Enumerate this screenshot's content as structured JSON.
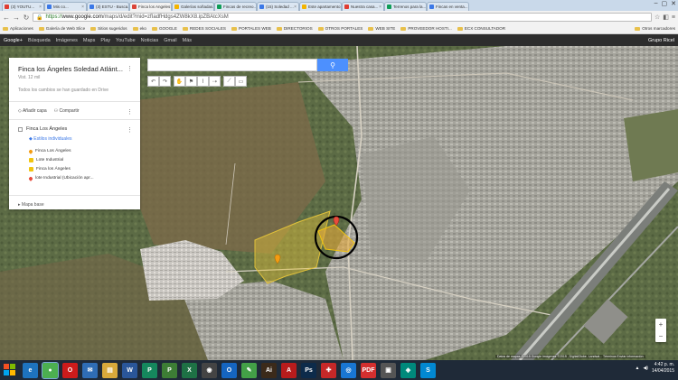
{
  "browser": {
    "tabs": [
      {
        "label": "(3) YOUTU...",
        "fav": "#e03c31",
        "active": false
      },
      {
        "label": "Mis co...",
        "fav": "#3b78e7",
        "active": false
      },
      {
        "label": "(3) ESTU - Busca...",
        "fav": "#3b78e7",
        "active": false
      },
      {
        "label": "Finca los Angeles",
        "fav": "#db4437",
        "active": true
      },
      {
        "label": "Galerías soñadas...",
        "fav": "#f4b400",
        "active": false
      },
      {
        "label": "Fincas de recreo...",
        "fav": "#0f9d58",
        "active": false
      },
      {
        "label": "(15) Soledad ...",
        "fav": "#3b78e7",
        "active": false
      },
      {
        "label": "Este apartamento...",
        "fav": "#f4b400",
        "active": false
      },
      {
        "label": "Nuestra casa...",
        "fav": "#e03c31",
        "active": false
      },
      {
        "label": "Terrenos para la...",
        "fav": "#0f9d58",
        "active": false
      },
      {
        "label": "Fincas en venta...",
        "fav": "#3b78e7",
        "active": false
      }
    ],
    "url_scheme": "https://",
    "url_host": "www.google.com",
    "url_path": "/maps/d/edit?mid=zfIadfHdgs4ZW8kX8.ipZBAtcXsM",
    "bookmarks": [
      "Aplicaciones",
      "Galería de Web Slice",
      "Sitios sugeridos",
      "eko",
      "GOOGLE",
      "REDES SOCIALES",
      "PORTALES WEB",
      "DIRECTORIOS",
      "OTROS PORTALES",
      "WEB SITE",
      "PROVEEDOR HOSTI...",
      "ECX CONSULTADOR"
    ],
    "bookmarks_other": "Otros marcadores"
  },
  "gbar": {
    "items": [
      "Google+",
      "Búsqueda",
      "Imágenes",
      "Maps",
      "Play",
      "YouTube",
      "Noticias",
      "Gmail",
      "Más"
    ],
    "user": "Grupo Ricel"
  },
  "map": {
    "search_placeholder": "",
    "panel": {
      "title": "Finca los Ángeles Soledad Atlánt...",
      "views": "Vist. 12 mil",
      "saved": "Todos los cambios se han guardado en Drive",
      "add_layer": "Añadir capa",
      "share": "Compartir",
      "layer_name": "Finca Los Ángeles",
      "style_link": "Estilos individuales",
      "items": [
        {
          "label": "Finca Los Ángeles",
          "color": "#f39c12",
          "shape": "pin"
        },
        {
          "label": "Lote Industrial",
          "color": "#f1c40f",
          "shape": "square"
        },
        {
          "label": "Finca los Ángeles",
          "color": "#f1c40f",
          "shape": "square"
        },
        {
          "label": "lote Industrial (Ubicación apr...",
          "color": "#e74c3c",
          "shape": "pin"
        }
      ],
      "base_map": "Mapa base"
    },
    "attribution": "Datos de mapas ©2015 Google Imágenes ©2015 , DigitalGlobe, Landsat... Términos Enviar información"
  },
  "taskbar": {
    "apps": [
      {
        "name": "ie-app",
        "label": "e",
        "color": "#1e73be"
      },
      {
        "name": "chrome-app",
        "label": "●",
        "color": "#4caf50",
        "active": true
      },
      {
        "name": "opera-app",
        "label": "O",
        "color": "#cc1b1b"
      },
      {
        "name": "outlook-app",
        "label": "✉",
        "color": "#2f6db5"
      },
      {
        "name": "explorer-app",
        "label": "▤",
        "color": "#d8a93b"
      },
      {
        "name": "word-app",
        "label": "W",
        "color": "#2a5699"
      },
      {
        "name": "publisher-app",
        "label": "P",
        "color": "#15875d"
      },
      {
        "name": "project-app",
        "label": "P",
        "color": "#3d7d35"
      },
      {
        "name": "excel-app",
        "label": "X",
        "color": "#1e7145"
      },
      {
        "name": "camera-app",
        "label": "◉",
        "color": "#444"
      },
      {
        "name": "outlook2-app",
        "label": "O",
        "color": "#1565c0"
      },
      {
        "name": "app-green",
        "label": "✎",
        "color": "#43a047"
      },
      {
        "name": "illustrator-app",
        "label": "Ai",
        "color": "#3b2a1a"
      },
      {
        "name": "acrobat-app",
        "label": "A",
        "color": "#b71c1c"
      },
      {
        "name": "photoshop-app",
        "label": "Ps",
        "color": "#0d2b4a"
      },
      {
        "name": "app-red",
        "label": "✚",
        "color": "#c62828"
      },
      {
        "name": "app-globe",
        "label": "◎",
        "color": "#1976d2"
      },
      {
        "name": "pdf-app",
        "label": "PDF",
        "color": "#d32f2f"
      },
      {
        "name": "app-grey",
        "label": "▣",
        "color": "#555"
      },
      {
        "name": "app-teal",
        "label": "◈",
        "color": "#00897b"
      },
      {
        "name": "skype-app",
        "label": "S",
        "color": "#0288d1"
      }
    ],
    "time": "4:42 p. m.",
    "date": "14/04/2015"
  }
}
